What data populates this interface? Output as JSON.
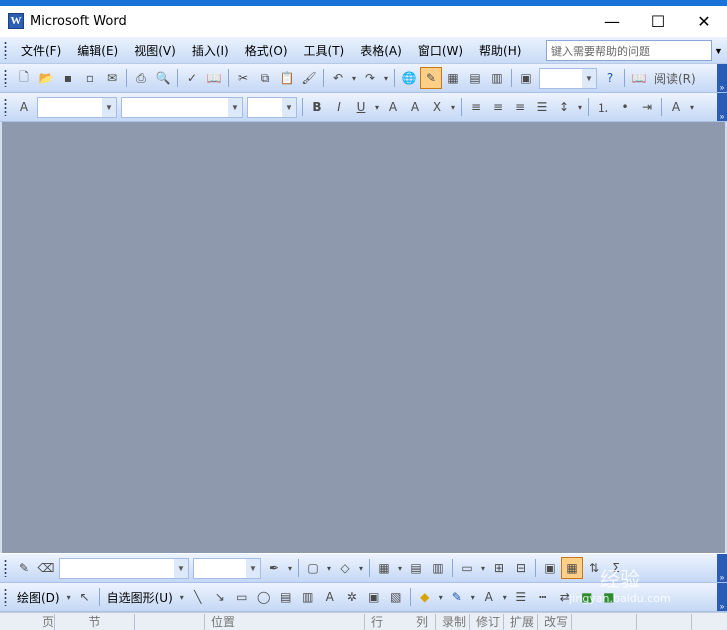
{
  "window": {
    "title": "Microsoft Word",
    "icon_letter": "W",
    "minimize": "—",
    "maximize": "☐",
    "close": "✕"
  },
  "menu": {
    "items": [
      "文件(F)",
      "编辑(E)",
      "视图(V)",
      "插入(I)",
      "格式(O)",
      "工具(T)",
      "表格(A)",
      "窗口(W)",
      "帮助(H)"
    ],
    "help_placeholder": "键入需要帮助的问题"
  },
  "standard_toolbar": {
    "reading_label": "阅读(R)"
  },
  "drawing_toolbar": {
    "draw_label": "绘图(D)",
    "autoshapes_label": "自选图形(U)"
  },
  "status_bar": [
    "页",
    "节",
    "",
    "位置",
    "行",
    "列",
    "录制",
    "修订",
    "扩展",
    "改写"
  ],
  "watermark": {
    "main": "经验",
    "url": "jingyan.baidu.com"
  },
  "colors": {
    "workspace": "#8f99ae",
    "toolbar_light": "#eef4fe",
    "toolbar_dark": "#c4d8f5",
    "accent": "#2a5cb6"
  }
}
